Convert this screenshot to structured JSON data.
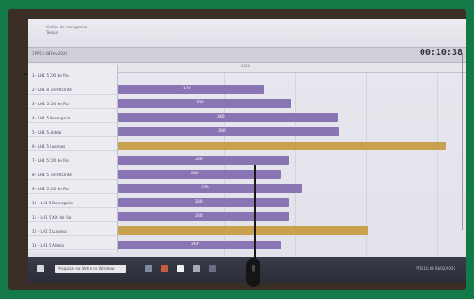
{
  "screen": {
    "title_line_1": "Gráfico de cronograma",
    "title_line_2": "Tempo",
    "timeline_label": "1 PPC / 08 Fev 2020",
    "timer": "00:10:38",
    "ruler_label": "2020"
  },
  "rows": [
    {
      "name": "1 - LH1 5 XXI de Rio",
      "bar_value": ""
    },
    {
      "name": "2 - LH1 8 Torreficante",
      "bar_value": "170"
    },
    {
      "name": "3 - LH1 5 XXI de Rio",
      "bar_value": "300"
    },
    {
      "name": "4 - LH1 5 Berengaria",
      "bar_value": "380"
    },
    {
      "name": "5 - LH1 5 Aldeia",
      "bar_value": "380"
    },
    {
      "name": "6 - LH1 5 Lusanos",
      "bar_value": ""
    },
    {
      "name": "7 - LH1 5 XXI de Rio",
      "bar_value": "300"
    },
    {
      "name": "8 - LH1 5 Torreficante",
      "bar_value": "280"
    },
    {
      "name": "9 - LH1 5 XXI de Rio",
      "bar_value": "370"
    },
    {
      "name": "10 - LH1 5 Berengaria",
      "bar_value": "280"
    },
    {
      "name": "11 - LH1 5 XXI de Rio",
      "bar_value": "280"
    },
    {
      "name": "12 - LH1 5 Lusanos",
      "bar_value": ""
    },
    {
      "name": "13 - LH1 5 Aldeia",
      "bar_value": "260"
    }
  ],
  "taskbar": {
    "search_text": "Pesquisar na Web e no Windows",
    "tray_text": "PTB 11:08 08/02/2020"
  },
  "colors": {
    "frame": "#137a47",
    "bar_purple": "#8a75b4",
    "bar_gold": "#c8a24e"
  }
}
